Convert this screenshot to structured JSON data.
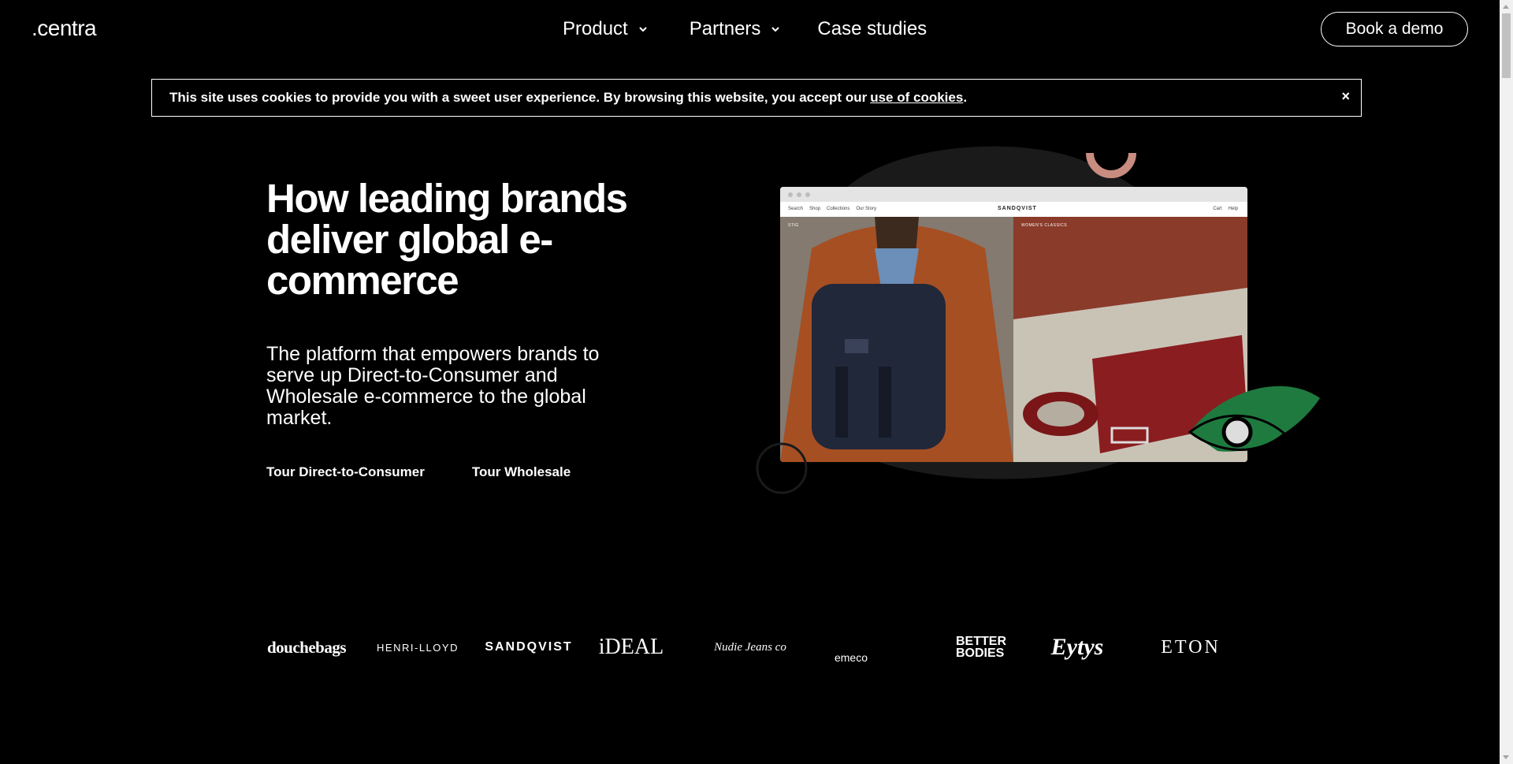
{
  "header": {
    "logo": "centra",
    "nav": [
      {
        "label": "Product",
        "has_dropdown": true
      },
      {
        "label": "Partners",
        "has_dropdown": true
      },
      {
        "label": "Case studies",
        "has_dropdown": false
      }
    ],
    "cta": "Book a demo"
  },
  "cookie_banner": {
    "text": "This site uses cookies to provide you with a sweet user experience. By browsing this website, you accept our",
    "link": "use of cookies",
    "suffix": ".",
    "close": "×"
  },
  "hero": {
    "title": "How leading brands deliver global e-commerce",
    "subtitle": "The platform that empowers brands to serve up Direct-to-Consumer and Wholesale e-commerce to the global market.",
    "link_dtc": "Tour Direct-to-Consumer",
    "link_wholesale": "Tour Wholesale"
  },
  "mockup": {
    "nav_left": [
      "Search",
      "Shop",
      "Collections",
      "Our Story"
    ],
    "brand": "SANDQVIST",
    "nav_right": [
      "Cart",
      "Help"
    ],
    "left_tag": "STIG",
    "right_tag": "WOMEN'S CLASSICS"
  },
  "brand_logos": [
    "douchebags",
    "HENRI-LLOYD",
    "SANDQVIST",
    "iDEAL",
    "Nudie Jeans co",
    "emeco",
    "BETTER BODIES",
    "Eytys",
    "ETON"
  ],
  "colors": {
    "background": "#000000",
    "accent_green": "#1f7a3f",
    "accent_pink": "#c98c80"
  }
}
